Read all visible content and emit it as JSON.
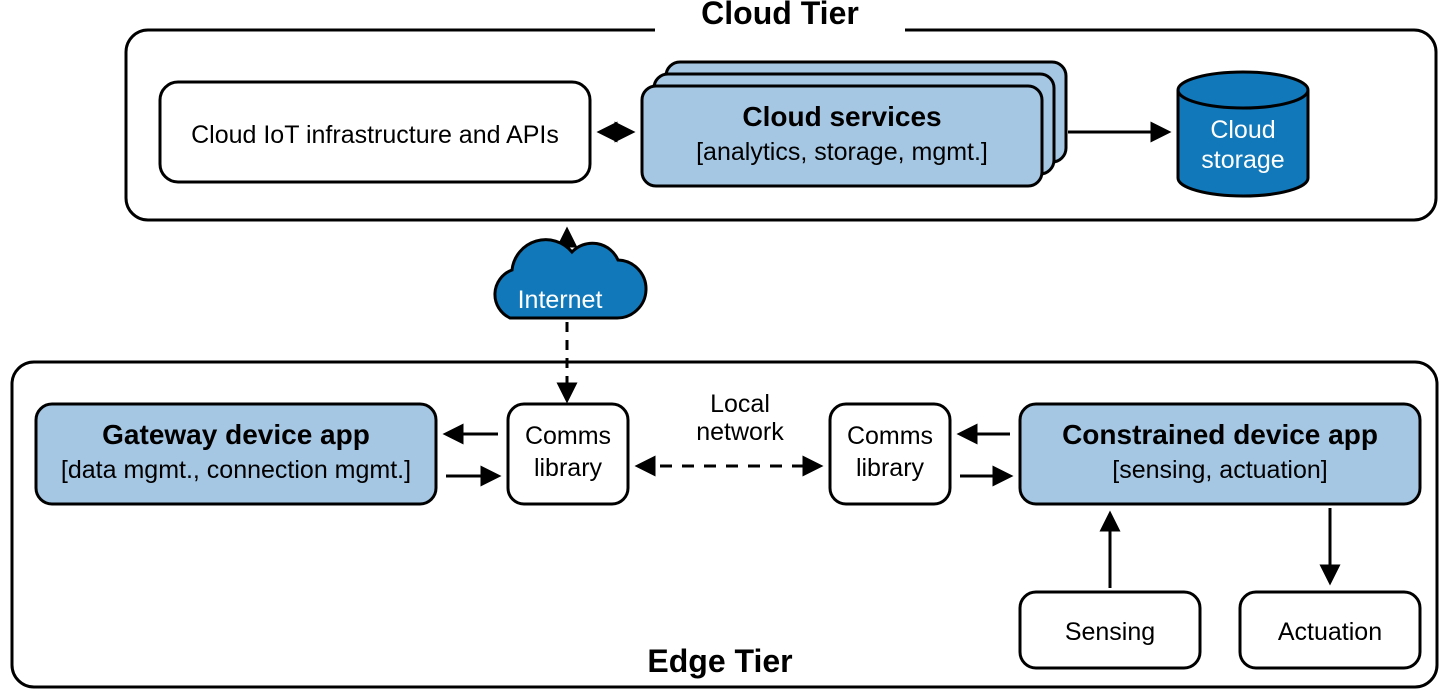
{
  "tiers": {
    "cloud": {
      "title": "Cloud Tier"
    },
    "edge": {
      "title": "Edge Tier"
    }
  },
  "boxes": {
    "cloud_infra": {
      "title": "Cloud IoT infrastructure and APIs"
    },
    "cloud_services": {
      "title": "Cloud services",
      "subtitle": "[analytics, storage, mgmt.]"
    },
    "cloud_storage": {
      "line1": "Cloud",
      "line2": "storage"
    },
    "gateway": {
      "title": "Gateway device app",
      "subtitle": "[data mgmt., connection mgmt.]"
    },
    "comms_left": {
      "line1": "Comms",
      "line2": "library"
    },
    "comms_right": {
      "line1": "Comms",
      "line2": "library"
    },
    "constrained": {
      "title": "Constrained device app",
      "subtitle": "[sensing, actuation]"
    },
    "sensing": {
      "title": "Sensing"
    },
    "actuation": {
      "title": "Actuation"
    }
  },
  "labels": {
    "internet": "Internet",
    "local_network_l1": "Local",
    "local_network_l2": "network"
  },
  "colors": {
    "light_blue": "#a5c7e3",
    "deep_blue": "#1178b9",
    "black": "#000000"
  }
}
